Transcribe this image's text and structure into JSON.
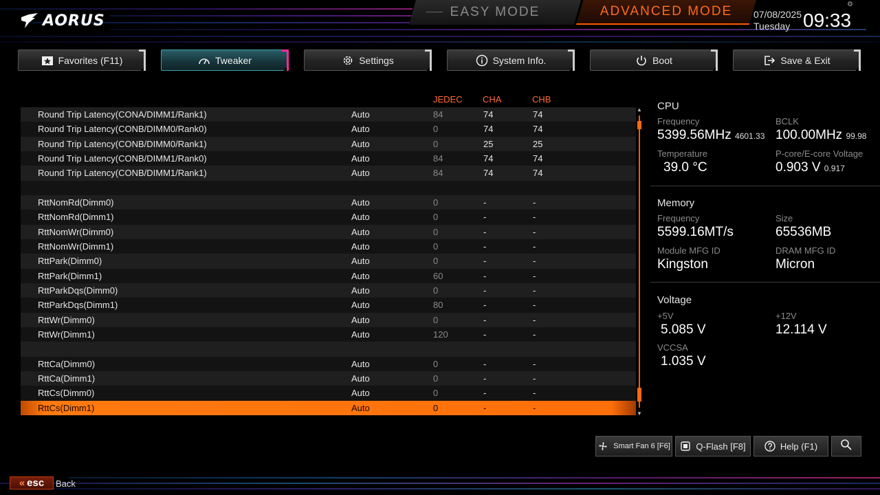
{
  "header": {
    "brand": "AORUS",
    "easy_mode": "EASY MODE",
    "advanced_mode": "ADVANCED MODE",
    "date": "07/08/2025",
    "day": "Tuesday",
    "time": "09:33"
  },
  "tabs": [
    {
      "label": "Favorites (F11)",
      "icon": "star-icon"
    },
    {
      "label": "Tweaker",
      "icon": "speedometer-icon"
    },
    {
      "label": "Settings",
      "icon": "gear-icon"
    },
    {
      "label": "System Info.",
      "icon": "info-icon"
    },
    {
      "label": "Boot",
      "icon": "power-icon"
    },
    {
      "label": "Save & Exit",
      "icon": "exit-icon"
    }
  ],
  "table": {
    "col_jedec": "JEDEC",
    "col_cha": "CHA",
    "col_chb": "CHB",
    "rows": [
      {
        "name": "Round Trip Latency(CONA/DIMM1/Rank1)",
        "value": "Auto",
        "jedec": "84",
        "cha": "74",
        "chb": "74"
      },
      {
        "name": "Round Trip Latency(CONB/DIMM0/Rank0)",
        "value": "Auto",
        "jedec": "0",
        "cha": "74",
        "chb": "74"
      },
      {
        "name": "Round Trip Latency(CONB/DIMM0/Rank1)",
        "value": "Auto",
        "jedec": "0",
        "cha": "25",
        "chb": "25"
      },
      {
        "name": "Round Trip Latency(CONB/DIMM1/Rank0)",
        "value": "Auto",
        "jedec": "84",
        "cha": "74",
        "chb": "74"
      },
      {
        "name": "Round Trip Latency(CONB/DIMM1/Rank1)",
        "value": "Auto",
        "jedec": "84",
        "cha": "74",
        "chb": "74"
      },
      {
        "name": "",
        "value": "",
        "jedec": "",
        "cha": "",
        "chb": ""
      },
      {
        "name": "RttNomRd(Dimm0)",
        "value": "Auto",
        "jedec": "0",
        "cha": "-",
        "chb": "-"
      },
      {
        "name": "RttNomRd(Dimm1)",
        "value": "Auto",
        "jedec": "0",
        "cha": "-",
        "chb": "-"
      },
      {
        "name": "RttNomWr(Dimm0)",
        "value": "Auto",
        "jedec": "0",
        "cha": "-",
        "chb": "-"
      },
      {
        "name": "RttNomWr(Dimm1)",
        "value": "Auto",
        "jedec": "0",
        "cha": "-",
        "chb": "-"
      },
      {
        "name": "RttPark(Dimm0)",
        "value": "Auto",
        "jedec": "0",
        "cha": "-",
        "chb": "-"
      },
      {
        "name": "RttPark(Dimm1)",
        "value": "Auto",
        "jedec": "60",
        "cha": "-",
        "chb": "-"
      },
      {
        "name": "RttParkDqs(Dimm0)",
        "value": "Auto",
        "jedec": "0",
        "cha": "-",
        "chb": "-"
      },
      {
        "name": "RttParkDqs(Dimm1)",
        "value": "Auto",
        "jedec": "80",
        "cha": "-",
        "chb": "-"
      },
      {
        "name": "RttWr(Dimm0)",
        "value": "Auto",
        "jedec": "0",
        "cha": "-",
        "chb": "-"
      },
      {
        "name": "RttWr(Dimm1)",
        "value": "Auto",
        "jedec": "120",
        "cha": "-",
        "chb": "-"
      },
      {
        "name": "",
        "value": "",
        "jedec": "",
        "cha": "",
        "chb": ""
      },
      {
        "name": "RttCa(Dimm0)",
        "value": "Auto",
        "jedec": "0",
        "cha": "-",
        "chb": "-"
      },
      {
        "name": "RttCa(Dimm1)",
        "value": "Auto",
        "jedec": "0",
        "cha": "-",
        "chb": "-"
      },
      {
        "name": "RttCs(Dimm0)",
        "value": "Auto",
        "jedec": "0",
        "cha": "-",
        "chb": "-"
      },
      {
        "name": "RttCs(Dimm1)",
        "value": "Auto",
        "jedec": "0",
        "cha": "-",
        "chb": "-",
        "selected": true
      }
    ]
  },
  "info": {
    "cpu": {
      "title": "CPU",
      "freq_label": "Frequency",
      "freq": "5399.56MHz",
      "freq_sub": "4601.33",
      "bclk_label": "BCLK",
      "bclk": "100.00MHz",
      "bclk_sub": "99.98",
      "temp_label": "Temperature",
      "temp": "39.0 °C",
      "volt_label": "P-core/E-core Voltage",
      "volt": "0.903 V",
      "volt_sub": "0.917"
    },
    "memory": {
      "title": "Memory",
      "freq_label": "Frequency",
      "freq": "5599.16MT/s",
      "size_label": "Size",
      "size": "65536MB",
      "module_label": "Module MFG ID",
      "module": "Kingston",
      "dram_label": "DRAM MFG ID",
      "dram": "Micron"
    },
    "voltage": {
      "title": "Voltage",
      "v5_label": "+5V",
      "v5": "5.085 V",
      "v12_label": "+12V",
      "v12": "12.114 V",
      "vccsa_label": "VCCSA",
      "vccsa": "1.035 V"
    }
  },
  "bottom": {
    "smart_fan": "Smart Fan 6 [F6]",
    "qflash": "Q-Flash [F8]",
    "help": "Help (F1)",
    "esc": "esc",
    "back": "Back"
  },
  "colors": {
    "accent_orange": "#ff6a10",
    "tab_active": "#2b5d66",
    "header_red": "#ff6a3a"
  }
}
